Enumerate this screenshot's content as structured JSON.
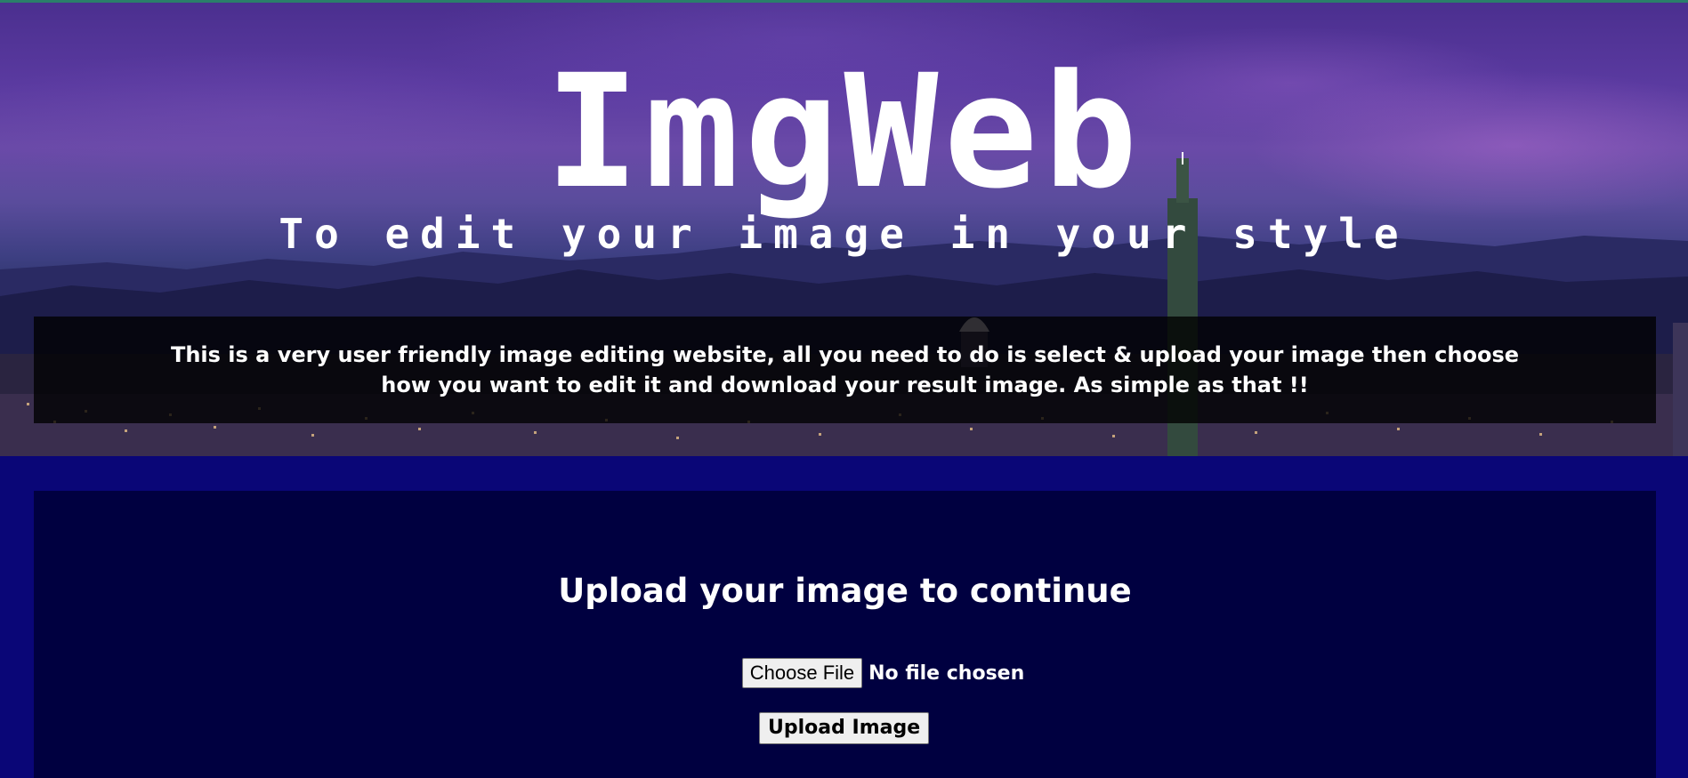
{
  "hero": {
    "logo": "ImgWeb",
    "tagline": "To edit your image in your style",
    "intro": "This is a very user friendly image editing website, all you need to do is select & upload your image then choose how you want to edit it and download your result image. As simple as that !!"
  },
  "upload": {
    "title": "Upload your image to continue",
    "choose_label": "Choose File",
    "no_file_label": "No file chosen",
    "upload_label": "Upload Image"
  },
  "colors": {
    "page_bg": "#0a0677",
    "panel_bg": "#000040",
    "text": "#ffffff"
  }
}
